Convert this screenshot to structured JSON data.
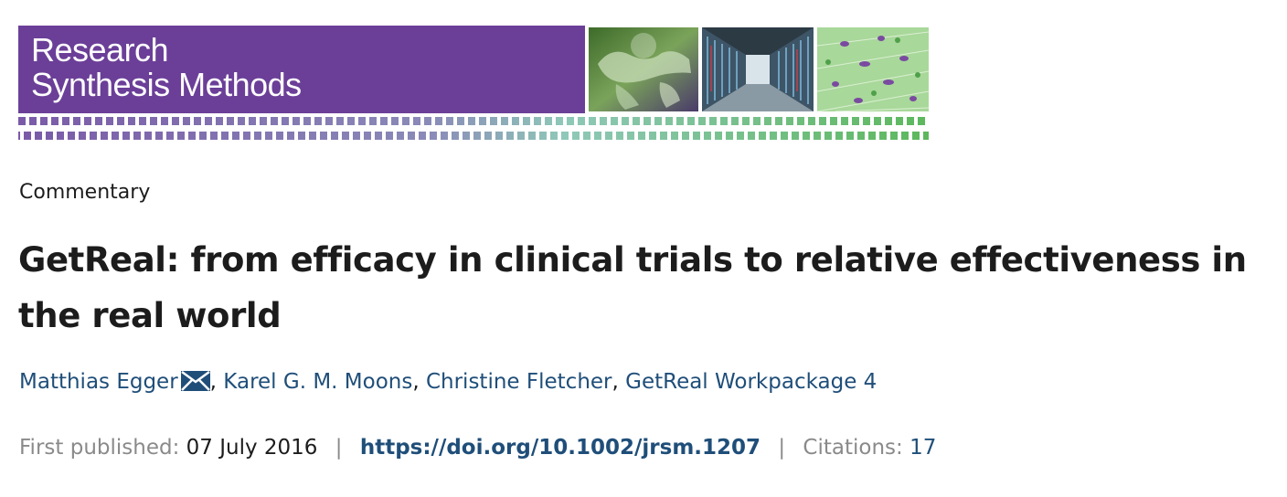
{
  "banner": {
    "journal_name": "Research\nSynthesis Methods",
    "colors": {
      "purple": "#6b3f98",
      "green": "#5cb85c"
    }
  },
  "article": {
    "type": "Commentary",
    "title": "GetReal: from efficacy in clinical trials to relative effectiveness in the real world"
  },
  "authors": [
    {
      "name": "Matthias Egger",
      "has_email": true
    },
    {
      "name": "Karel G. M. Moons",
      "has_email": false
    },
    {
      "name": "Christine Fletcher",
      "has_email": false
    },
    {
      "name": "GetReal Workpackage 4",
      "has_email": false
    }
  ],
  "author_separator": ", ",
  "email_icon": "envelope-icon",
  "publication": {
    "first_published_label": "First published:",
    "first_published_date": "07 July 2016",
    "divider": "|",
    "doi": "https://doi.org/10.1002/jrsm.1207",
    "citations_label": "Citations:",
    "citations_count": "17"
  }
}
